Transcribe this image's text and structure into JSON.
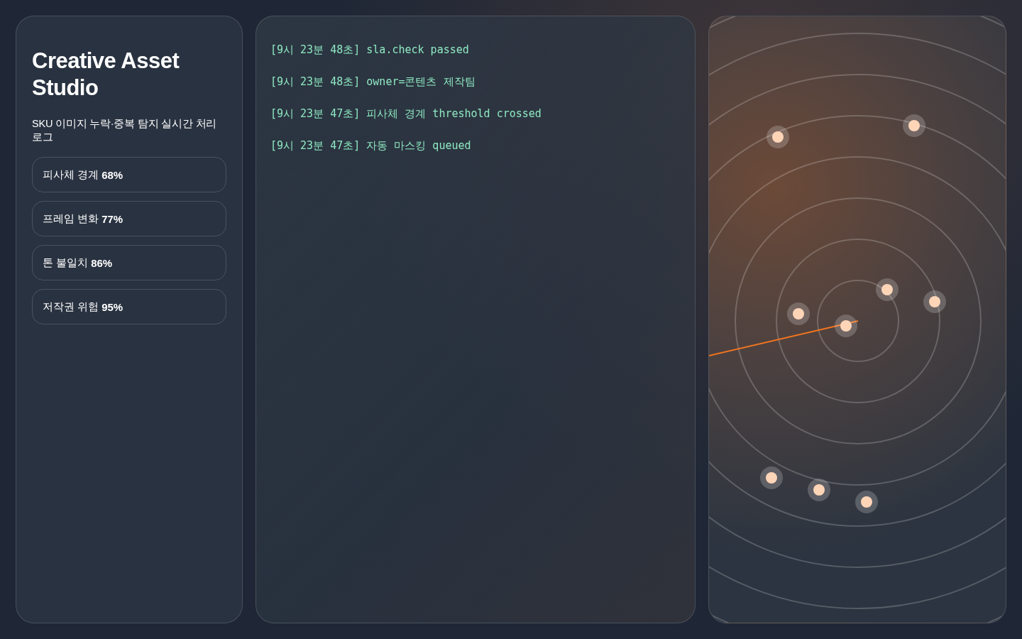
{
  "sidebar": {
    "title": "Creative Asset Studio",
    "subtitle": "SKU 이미지 누락·중복 탐지 실시간 처리 로그",
    "metrics": [
      {
        "label": "피사체 경계 **68%**"
      },
      {
        "label": "프레임 변화 **77%**"
      },
      {
        "label": "톤 불일치 **86%**"
      },
      {
        "label": "저작권 위험 **95%**"
      }
    ]
  },
  "log": {
    "lines": [
      {
        "time": "[9시 23분 48초]",
        "message": "sla.check passed"
      },
      {
        "time": "[9시 23분 48초]",
        "message": "owner=콘텐츠 제작팀"
      },
      {
        "time": "[9시 23분 47초]",
        "message": "피사체 경계 threshold crossed"
      },
      {
        "time": "[9시 23분 47초]",
        "message": "자동 마스킹 queued"
      }
    ]
  }
}
